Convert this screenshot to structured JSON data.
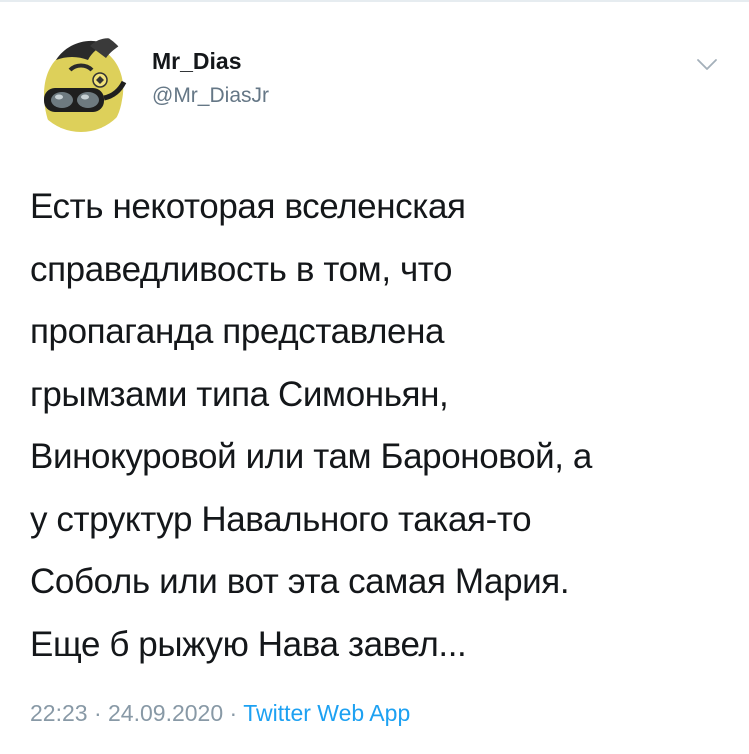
{
  "tweet": {
    "author": {
      "display_name": "Mr_Dias",
      "handle": "@Mr_DiasJr",
      "avatar_icon": "avatar-image"
    },
    "menu_icon": "chevron-down-icon",
    "text_lines": [
      "Есть некоторая вселенская",
      "справедливость в том, что",
      "пропаганда представлена",
      "грымзами типа Симоньян,",
      "Винокуровой или там Бароновой, а",
      "у структур Навального такая-то",
      "Соболь или вот эта самая Мария.",
      "Еще б рыжую Нава завел..."
    ],
    "time": "22:23",
    "separator": "·",
    "date": "24.09.2020",
    "source": "Twitter Web App"
  },
  "colors": {
    "text": "#14171a",
    "secondary": "#657786",
    "meta": "#8899a6",
    "link": "#1da1f2",
    "divider": "#e6ecf0"
  }
}
